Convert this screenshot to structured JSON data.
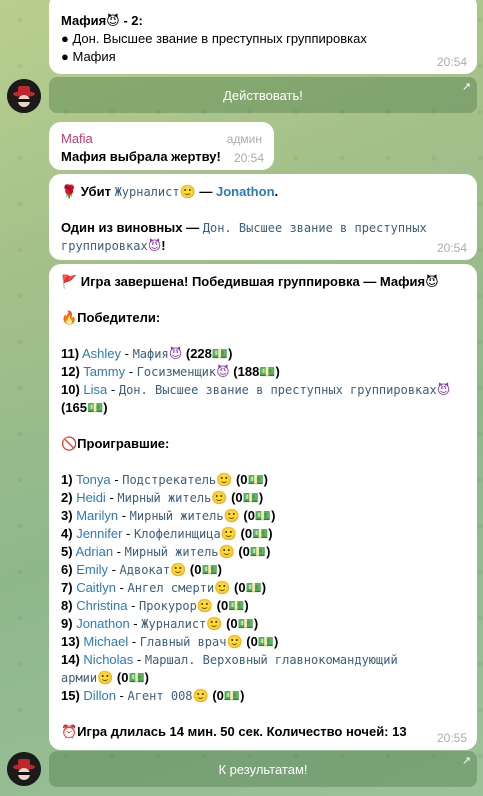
{
  "msg1": {
    "title": "Мафия😈 - 2:",
    "items": [
      "● Дон. Высшее звание в преступных группировках",
      "● Мафия"
    ],
    "time": "20:54"
  },
  "button1": {
    "label": "Действовать!",
    "arrow": "↗"
  },
  "msg2": {
    "sender": "Mafia",
    "role": "админ",
    "text": "Мафия выбрала жертву!",
    "time": "20:54"
  },
  "msg3": {
    "killed_prefix": "🌹 Убит ",
    "killed_role": "Журналист",
    "killed_emoji": "🙂",
    "dash": " — ",
    "killed_name": "Jonathon",
    "dot": ".",
    "guilty_prefix": "Один из виновных — ",
    "guilty_role_1": "Дон. Высшее звание в преступных",
    "guilty_role_2": "группировках",
    "guilty_emoji": "😈",
    "excl": "!",
    "time": "20:54"
  },
  "msg4": {
    "header": "🚩 Игра завершена! Победившая группировка — Мафия😈",
    "winners_title": "🔥Победители:",
    "winners": [
      {
        "num": "11)",
        "name": "Ashley",
        "sep": " - ",
        "role": "Мафия",
        "emoji": "😈",
        "score": " (228💵)"
      },
      {
        "num": "12)",
        "name": "Tammy",
        "sep": " - ",
        "role": "Госизменщик",
        "emoji": "😈",
        "score": " (188💵)"
      }
    ],
    "winner3": {
      "num": "10)",
      "name": "Lisa",
      "sep": " - ",
      "role": "Дон. Высшее звание в преступных группировках",
      "emoji": "😈",
      "score": " (165💵)"
    },
    "losers_title": "🚫Проигравшие:",
    "losers": [
      {
        "num": "1)",
        "name": "Tonya",
        "sep": " - ",
        "role": "Подстрекатель",
        "emoji": "🙂",
        "score": " (0💵)"
      },
      {
        "num": "2)",
        "name": "Heidi",
        "sep": " - ",
        "role": "Мирный житель",
        "emoji": "🙂",
        "score": " (0💵)"
      },
      {
        "num": "3)",
        "name": "Marilyn",
        "sep": " - ",
        "role": "Мирный житель",
        "emoji": "🙂",
        "score": " (0💵)"
      },
      {
        "num": "4)",
        "name": "Jennifer",
        "sep": " - ",
        "role": "Клофелинщица",
        "emoji": "🙂",
        "score": " (0💵)"
      },
      {
        "num": "5)",
        "name": "Adrian",
        "sep": " - ",
        "role": "Мирный житель",
        "emoji": "🙂",
        "score": " (0💵)"
      },
      {
        "num": "6)",
        "name": "Emily",
        "sep": " - ",
        "role": "Адвокат",
        "emoji": "🙂",
        "score": " (0💵)"
      },
      {
        "num": "7)",
        "name": "Caitlyn",
        "sep": " - ",
        "role": "Ангел смерти",
        "emoji": "🙂",
        "score": " (0💵)"
      },
      {
        "num": "8)",
        "name": "Christina",
        "sep": " - ",
        "role": "Прокурор",
        "emoji": "🙂",
        "score": " (0💵)"
      },
      {
        "num": "9)",
        "name": "Jonathon",
        "sep": " - ",
        "role": "Журналист",
        "emoji": "🙂",
        "score": " (0💵)"
      },
      {
        "num": "13)",
        "name": "Michael",
        "sep": " - ",
        "role": "Главный врач",
        "emoji": "🙂",
        "score": " (0💵)"
      }
    ],
    "loser14": {
      "num": "14)",
      "name": "Nicholas",
      "sep": " - ",
      "role_1": "Маршал. Верховный главнокомандующий",
      "role_2": "армии",
      "emoji": "🙂",
      "score": " (0💵)"
    },
    "loser15": {
      "num": "15)",
      "name": "Dillon",
      "sep": " - ",
      "role": "Агент 008",
      "emoji": "🙂",
      "score": " (0💵)"
    },
    "footer": "⏰Игра длилась 14 мин. 50 сек. Количество ночей: 13",
    "time": "20:55"
  },
  "button2": {
    "label": "К результатам!",
    "arrow": "↗"
  }
}
